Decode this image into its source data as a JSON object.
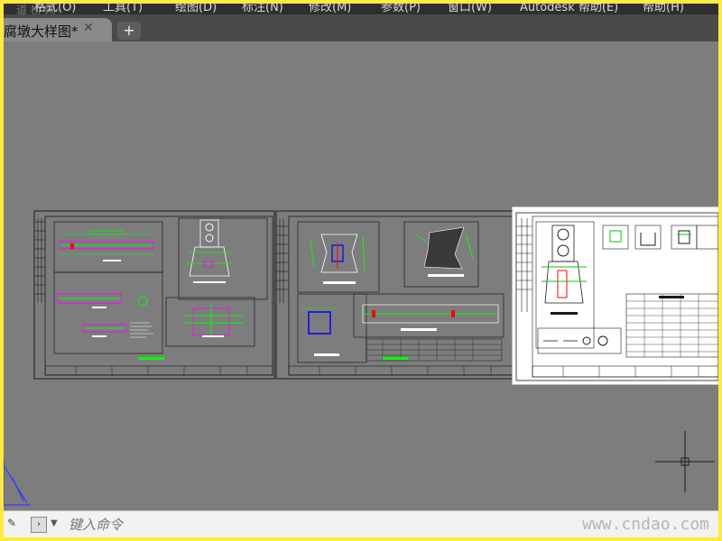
{
  "menu": {
    "items": [
      "格式(O)",
      "工具(T)",
      "绘图(D)",
      "标注(N)",
      "修改(M)",
      "参数(P)",
      "窗口(W)",
      "Autodesk 帮助(E)",
      "帮助(H)"
    ]
  },
  "tab": {
    "title": "腐墩大样图*",
    "close_symbol": "✕",
    "new_symbol": "+"
  },
  "watermark_top": "道 桥 网",
  "command": {
    "placeholder": "键入命令",
    "site_mark": "www.cndao.com"
  },
  "colors": {
    "background": "#7d7d7d",
    "sheet_border": "#1a1a1a",
    "green": "#00ff00",
    "magenta": "#ff00ff",
    "blue": "#0000ff",
    "red": "#ff0000",
    "highlight_sheet": "#ffffff"
  },
  "icons": [
    "wrench-icon",
    "command-prompt-icon",
    "chevron-down-icon",
    "close-icon",
    "plus-icon",
    "crosshair-cursor",
    "ucs-icon"
  ]
}
